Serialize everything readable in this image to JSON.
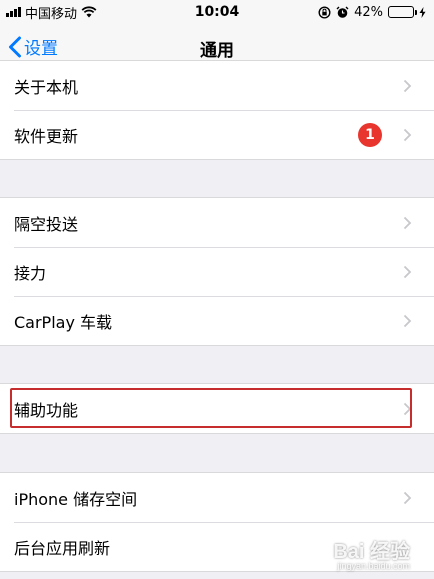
{
  "status_bar": {
    "carrier": "中国移动",
    "time": "10:04",
    "battery_percent": "42%",
    "battery_level": 0.42,
    "battery_color": "#4cd964"
  },
  "nav": {
    "back_label": "设置",
    "title": "通用",
    "accent_color": "#007aff"
  },
  "sections": [
    {
      "items": [
        {
          "label": "关于本机"
        },
        {
          "label": "软件更新",
          "badge": "1"
        }
      ]
    },
    {
      "items": [
        {
          "label": "隔空投送"
        },
        {
          "label": "接力"
        },
        {
          "label": "CarPlay 车载"
        }
      ]
    },
    {
      "items": [
        {
          "label": "辅助功能",
          "highlighted": true
        }
      ]
    },
    {
      "items": [
        {
          "label": "iPhone 储存空间"
        },
        {
          "label": "后台应用刷新"
        }
      ]
    }
  ],
  "watermark": {
    "text": "Bai 经验",
    "url": "jingyan.baidu.com"
  }
}
